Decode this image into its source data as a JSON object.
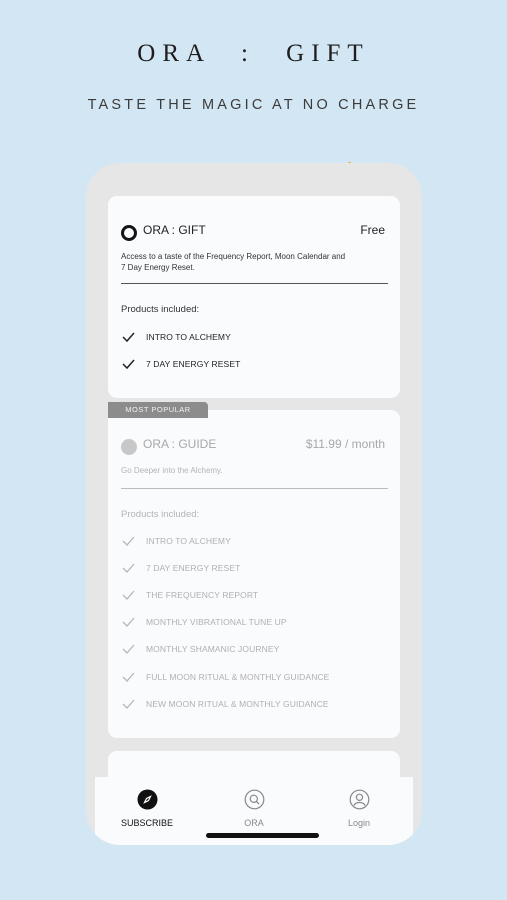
{
  "header": {
    "title": "ORA : GIFT",
    "subtitle": "TASTE THE MAGIC AT NO CHARGE"
  },
  "plans": [
    {
      "name": "ORA : GIFT",
      "price": "Free",
      "selected": true,
      "description": "Access to a taste of the Frequency Report, Moon Calendar and 7 Day Energy Reset.",
      "included_label": "Products included:",
      "items": [
        "INTRO TO ALCHEMY",
        "7 DAY ENERGY RESET"
      ]
    },
    {
      "badge": "MOST POPULAR",
      "name": "ORA : GUIDE",
      "price": "$11.99 / month",
      "selected": false,
      "description": "Go Deeper into the Alchemy.",
      "included_label": "Products included:",
      "items": [
        "INTRO TO ALCHEMY",
        "7 DAY ENERGY RESET",
        "THE FREQUENCY REPORT",
        "MONTHLY VIBRATIONAL TUNE UP",
        "MONTHLY SHAMANIC JOURNEY",
        "FULL MOON RITUAL & MONTHLY GUIDANCE",
        "NEW MOON RITUAL & MONTHLY GUIDANCE"
      ]
    }
  ],
  "tabs": [
    {
      "label": "SUBSCRIBE",
      "icon": "compass-icon",
      "active": true
    },
    {
      "label": "ORA",
      "icon": "search-icon",
      "active": false
    },
    {
      "label": "Login",
      "icon": "user-icon",
      "active": false
    }
  ],
  "colors": {
    "background": "#d3e6f3",
    "card": "#fafbfd",
    "badge": "#8c8c8c",
    "accent_dot": "#f0a020"
  }
}
